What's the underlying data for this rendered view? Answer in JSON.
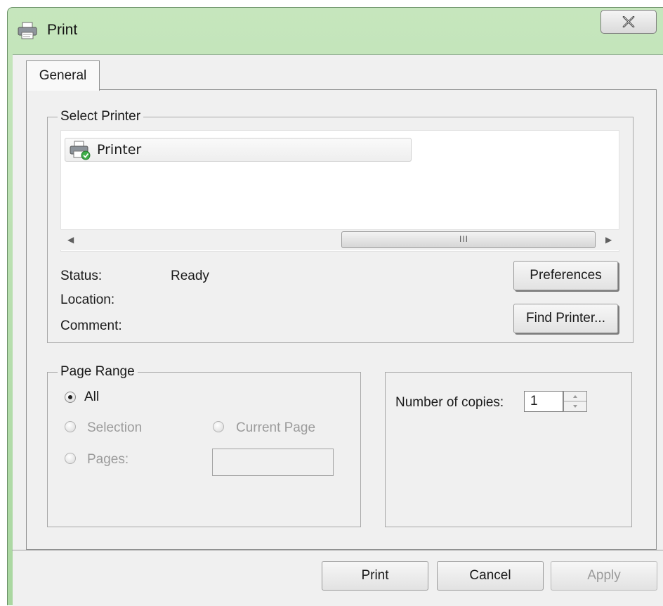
{
  "window": {
    "title": "Print",
    "close_label": "X"
  },
  "tabs": [
    {
      "label": "General",
      "active": true
    }
  ],
  "select_printer": {
    "legend": "Select Printer",
    "printers": [
      {
        "name": "Printer",
        "icon": "printer-ready-icon"
      }
    ],
    "scrollbar": {
      "grip": "III"
    },
    "status_label": "Status:",
    "status_value": "Ready",
    "location_label": "Location:",
    "location_value": "",
    "comment_label": "Comment:",
    "comment_value": "",
    "preferences_button": "Preferences",
    "find_printer_button": "Find Printer..."
  },
  "page_range": {
    "legend": "Page Range",
    "options": {
      "all": "All",
      "selection": "Selection",
      "current_page": "Current Page",
      "pages": "Pages:"
    },
    "selected": "all",
    "pages_value": ""
  },
  "copies": {
    "label": "Number of copies:",
    "value": "1"
  },
  "buttons": {
    "print": "Print",
    "cancel": "Cancel",
    "apply": "Apply"
  },
  "colors": {
    "titlebar": "#b7dfae",
    "dialog_bg": "#f0f0f0"
  }
}
